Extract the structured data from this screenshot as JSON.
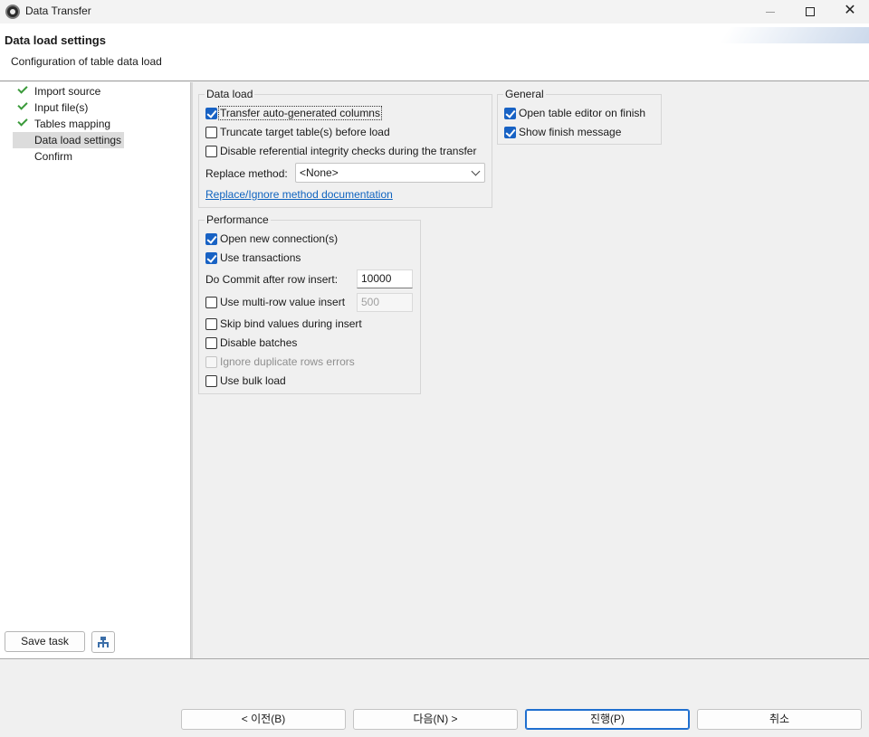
{
  "window": {
    "title": "Data Transfer",
    "controls": {
      "minimize": "—",
      "maximize": "☐",
      "close": "✕"
    }
  },
  "header": {
    "title": "Data load settings",
    "subtitle": "Configuration of table data load"
  },
  "nav": {
    "items": [
      {
        "label": "Import source",
        "completed": true,
        "selected": false
      },
      {
        "label": "Input file(s)",
        "completed": true,
        "selected": false
      },
      {
        "label": "Tables mapping",
        "completed": true,
        "selected": false
      },
      {
        "label": "Data load settings",
        "completed": false,
        "selected": true
      },
      {
        "label": "Confirm",
        "completed": false,
        "selected": false
      }
    ],
    "save_task_label": "Save task",
    "schedule_icon": "schedule-task-icon"
  },
  "data_load": {
    "title": "Data load",
    "transfer_auto_generated": {
      "label": "Transfer auto-generated columns",
      "checked": true
    },
    "truncate_target": {
      "label": "Truncate target table(s) before load",
      "checked": false
    },
    "disable_integrity": {
      "label": "Disable referential integrity checks during the transfer",
      "checked": false
    },
    "replace_method_label": "Replace method:",
    "replace_method_value": "<None>",
    "doc_link": "Replace/Ignore method documentation"
  },
  "general": {
    "title": "General",
    "open_table_editor": {
      "label": "Open table editor on finish",
      "checked": true
    },
    "show_finish_message": {
      "label": "Show finish message",
      "checked": true
    }
  },
  "performance": {
    "title": "Performance",
    "open_new_connection": {
      "label": "Open new connection(s)",
      "checked": true
    },
    "use_transactions": {
      "label": "Use transactions",
      "checked": true
    },
    "commit_label": "Do Commit after row insert:",
    "commit_value": "10000",
    "multi_row": {
      "label": "Use multi-row value insert",
      "checked": false
    },
    "multi_row_value": "500",
    "skip_bind": {
      "label": "Skip bind values during insert",
      "checked": false
    },
    "disable_batches": {
      "label": "Disable batches",
      "checked": false
    },
    "ignore_duplicates": {
      "label": "Ignore duplicate rows errors",
      "checked": false,
      "disabled": true
    },
    "bulk_load": {
      "label": "Use bulk load",
      "checked": false
    }
  },
  "footer": {
    "back": "< 이전(B)",
    "next": "다음(N) >",
    "proceed": "진행(P)",
    "cancel": "취소"
  },
  "colors": {
    "accent": "#1862c4",
    "link": "#0f63bf",
    "check_green": "#3a9a3a"
  }
}
